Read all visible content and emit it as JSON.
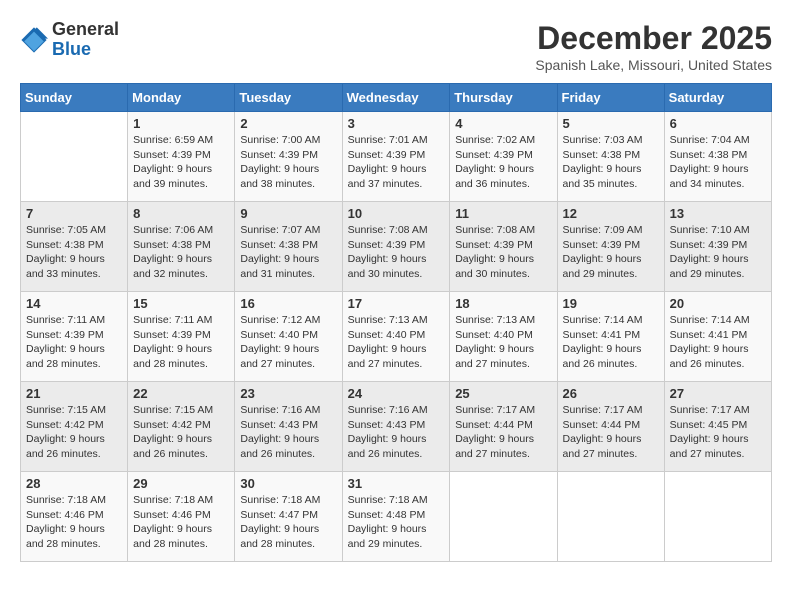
{
  "logo": {
    "general": "General",
    "blue": "Blue"
  },
  "header": {
    "month": "December 2025",
    "location": "Spanish Lake, Missouri, United States"
  },
  "weekdays": [
    "Sunday",
    "Monday",
    "Tuesday",
    "Wednesday",
    "Thursday",
    "Friday",
    "Saturday"
  ],
  "weeks": [
    [
      {
        "day": "",
        "text": ""
      },
      {
        "day": "1",
        "text": "Sunrise: 6:59 AM\nSunset: 4:39 PM\nDaylight: 9 hours\nand 39 minutes."
      },
      {
        "day": "2",
        "text": "Sunrise: 7:00 AM\nSunset: 4:39 PM\nDaylight: 9 hours\nand 38 minutes."
      },
      {
        "day": "3",
        "text": "Sunrise: 7:01 AM\nSunset: 4:39 PM\nDaylight: 9 hours\nand 37 minutes."
      },
      {
        "day": "4",
        "text": "Sunrise: 7:02 AM\nSunset: 4:39 PM\nDaylight: 9 hours\nand 36 minutes."
      },
      {
        "day": "5",
        "text": "Sunrise: 7:03 AM\nSunset: 4:38 PM\nDaylight: 9 hours\nand 35 minutes."
      },
      {
        "day": "6",
        "text": "Sunrise: 7:04 AM\nSunset: 4:38 PM\nDaylight: 9 hours\nand 34 minutes."
      }
    ],
    [
      {
        "day": "7",
        "text": "Sunrise: 7:05 AM\nSunset: 4:38 PM\nDaylight: 9 hours\nand 33 minutes."
      },
      {
        "day": "8",
        "text": "Sunrise: 7:06 AM\nSunset: 4:38 PM\nDaylight: 9 hours\nand 32 minutes."
      },
      {
        "day": "9",
        "text": "Sunrise: 7:07 AM\nSunset: 4:38 PM\nDaylight: 9 hours\nand 31 minutes."
      },
      {
        "day": "10",
        "text": "Sunrise: 7:08 AM\nSunset: 4:39 PM\nDaylight: 9 hours\nand 30 minutes."
      },
      {
        "day": "11",
        "text": "Sunrise: 7:08 AM\nSunset: 4:39 PM\nDaylight: 9 hours\nand 30 minutes."
      },
      {
        "day": "12",
        "text": "Sunrise: 7:09 AM\nSunset: 4:39 PM\nDaylight: 9 hours\nand 29 minutes."
      },
      {
        "day": "13",
        "text": "Sunrise: 7:10 AM\nSunset: 4:39 PM\nDaylight: 9 hours\nand 29 minutes."
      }
    ],
    [
      {
        "day": "14",
        "text": "Sunrise: 7:11 AM\nSunset: 4:39 PM\nDaylight: 9 hours\nand 28 minutes."
      },
      {
        "day": "15",
        "text": "Sunrise: 7:11 AM\nSunset: 4:39 PM\nDaylight: 9 hours\nand 28 minutes."
      },
      {
        "day": "16",
        "text": "Sunrise: 7:12 AM\nSunset: 4:40 PM\nDaylight: 9 hours\nand 27 minutes."
      },
      {
        "day": "17",
        "text": "Sunrise: 7:13 AM\nSunset: 4:40 PM\nDaylight: 9 hours\nand 27 minutes."
      },
      {
        "day": "18",
        "text": "Sunrise: 7:13 AM\nSunset: 4:40 PM\nDaylight: 9 hours\nand 27 minutes."
      },
      {
        "day": "19",
        "text": "Sunrise: 7:14 AM\nSunset: 4:41 PM\nDaylight: 9 hours\nand 26 minutes."
      },
      {
        "day": "20",
        "text": "Sunrise: 7:14 AM\nSunset: 4:41 PM\nDaylight: 9 hours\nand 26 minutes."
      }
    ],
    [
      {
        "day": "21",
        "text": "Sunrise: 7:15 AM\nSunset: 4:42 PM\nDaylight: 9 hours\nand 26 minutes."
      },
      {
        "day": "22",
        "text": "Sunrise: 7:15 AM\nSunset: 4:42 PM\nDaylight: 9 hours\nand 26 minutes."
      },
      {
        "day": "23",
        "text": "Sunrise: 7:16 AM\nSunset: 4:43 PM\nDaylight: 9 hours\nand 26 minutes."
      },
      {
        "day": "24",
        "text": "Sunrise: 7:16 AM\nSunset: 4:43 PM\nDaylight: 9 hours\nand 26 minutes."
      },
      {
        "day": "25",
        "text": "Sunrise: 7:17 AM\nSunset: 4:44 PM\nDaylight: 9 hours\nand 27 minutes."
      },
      {
        "day": "26",
        "text": "Sunrise: 7:17 AM\nSunset: 4:44 PM\nDaylight: 9 hours\nand 27 minutes."
      },
      {
        "day": "27",
        "text": "Sunrise: 7:17 AM\nSunset: 4:45 PM\nDaylight: 9 hours\nand 27 minutes."
      }
    ],
    [
      {
        "day": "28",
        "text": "Sunrise: 7:18 AM\nSunset: 4:46 PM\nDaylight: 9 hours\nand 28 minutes."
      },
      {
        "day": "29",
        "text": "Sunrise: 7:18 AM\nSunset: 4:46 PM\nDaylight: 9 hours\nand 28 minutes."
      },
      {
        "day": "30",
        "text": "Sunrise: 7:18 AM\nSunset: 4:47 PM\nDaylight: 9 hours\nand 28 minutes."
      },
      {
        "day": "31",
        "text": "Sunrise: 7:18 AM\nSunset: 4:48 PM\nDaylight: 9 hours\nand 29 minutes."
      },
      {
        "day": "",
        "text": ""
      },
      {
        "day": "",
        "text": ""
      },
      {
        "day": "",
        "text": ""
      }
    ]
  ]
}
